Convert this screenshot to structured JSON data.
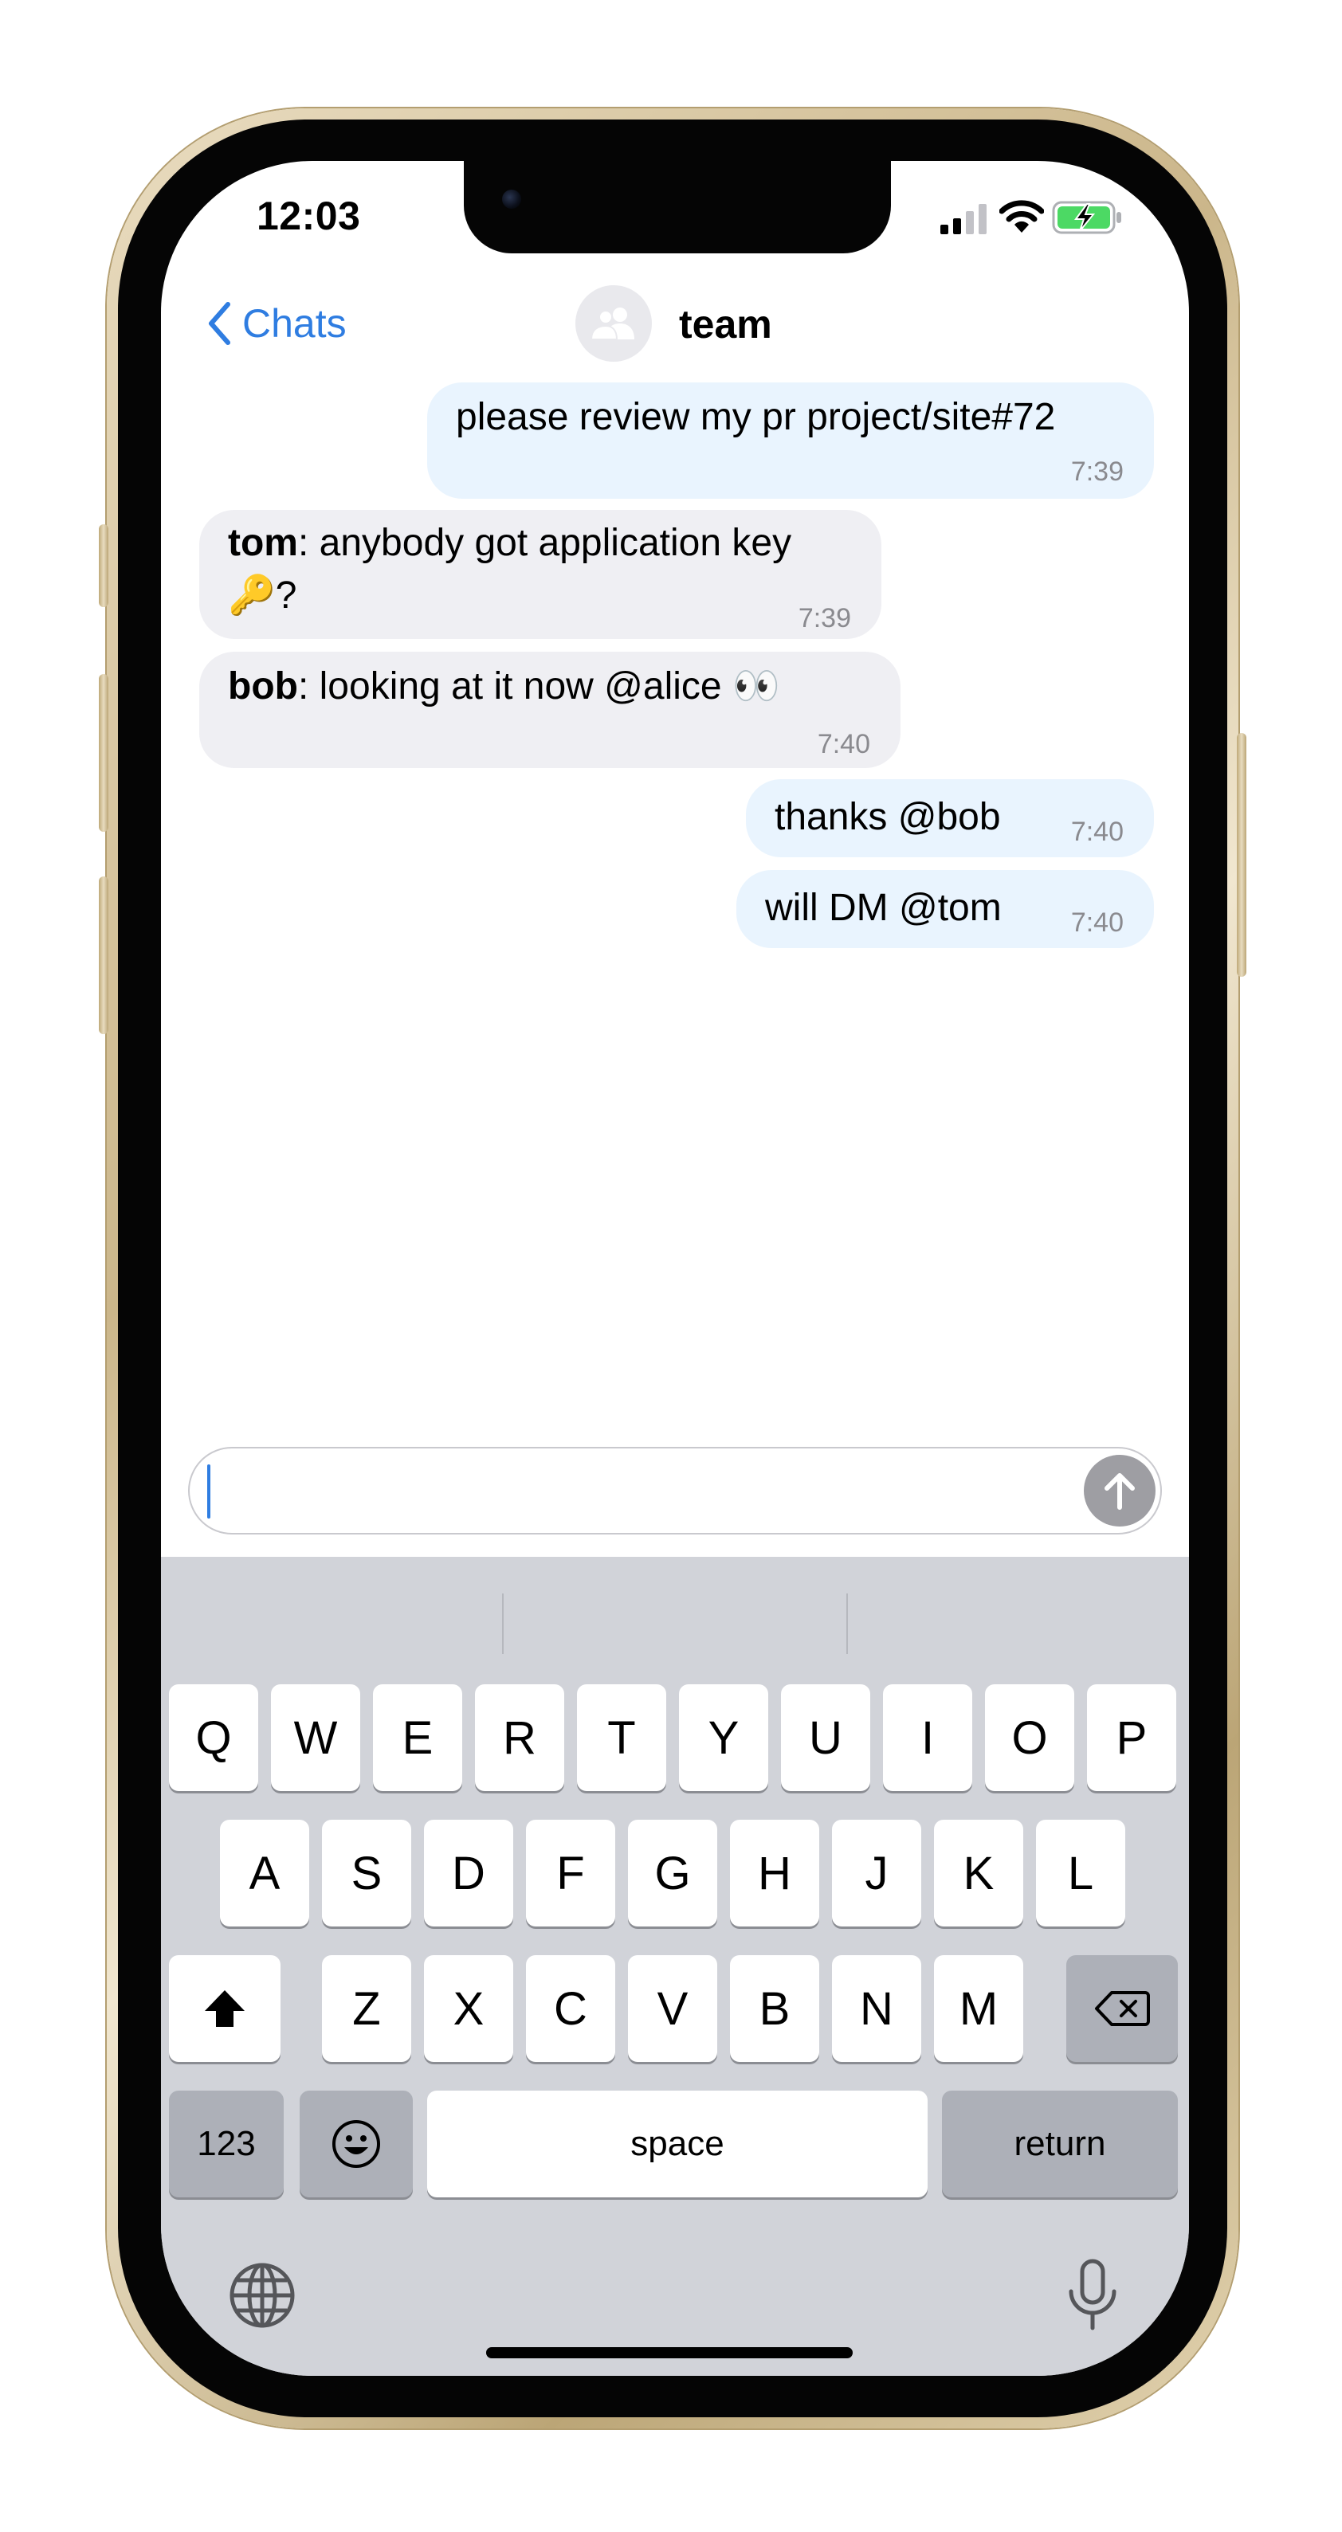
{
  "status_bar": {
    "time": "12:03"
  },
  "nav": {
    "back_label": "Chats",
    "title": "team"
  },
  "messages": [
    {
      "direction": "outgoing",
      "text": "please review my pr project/site#72",
      "time": "7:39"
    },
    {
      "direction": "incoming",
      "sender": "tom",
      "text_line1": ": anybody got application key",
      "text_line2": "🔑?",
      "time": "7:39"
    },
    {
      "direction": "incoming",
      "sender": "bob",
      "text": ": looking at it now @alice 👀",
      "time": "7:40"
    },
    {
      "direction": "outgoing",
      "text": "thanks @bob",
      "time": "7:40"
    },
    {
      "direction": "outgoing",
      "text": "will DM @tom",
      "time": "7:40"
    }
  ],
  "composer": {
    "value": ""
  },
  "keyboard": {
    "row1": [
      "Q",
      "W",
      "E",
      "R",
      "T",
      "Y",
      "U",
      "I",
      "O",
      "P"
    ],
    "row2": [
      "A",
      "S",
      "D",
      "F",
      "G",
      "H",
      "J",
      "K",
      "L"
    ],
    "row3": [
      "Z",
      "X",
      "C",
      "V",
      "B",
      "N",
      "M"
    ],
    "numbers_label": "123",
    "space_label": "space",
    "return_label": "return"
  },
  "icons": {
    "back": "chevron-left-icon",
    "group_avatar": "people-icon",
    "send": "arrow-up-icon",
    "signal": "cellular-signal-icon",
    "wifi": "wifi-icon",
    "battery": "battery-charging-icon",
    "shift": "shift-icon",
    "delete": "backspace-icon",
    "emoji": "emoji-icon",
    "globe": "globe-icon",
    "mic": "microphone-icon"
  },
  "colors": {
    "accent": "#2f7de1",
    "outgoing_bubble": "#e9f4fe",
    "incoming_bubble": "#efeff3",
    "battery": "#4cd964"
  }
}
